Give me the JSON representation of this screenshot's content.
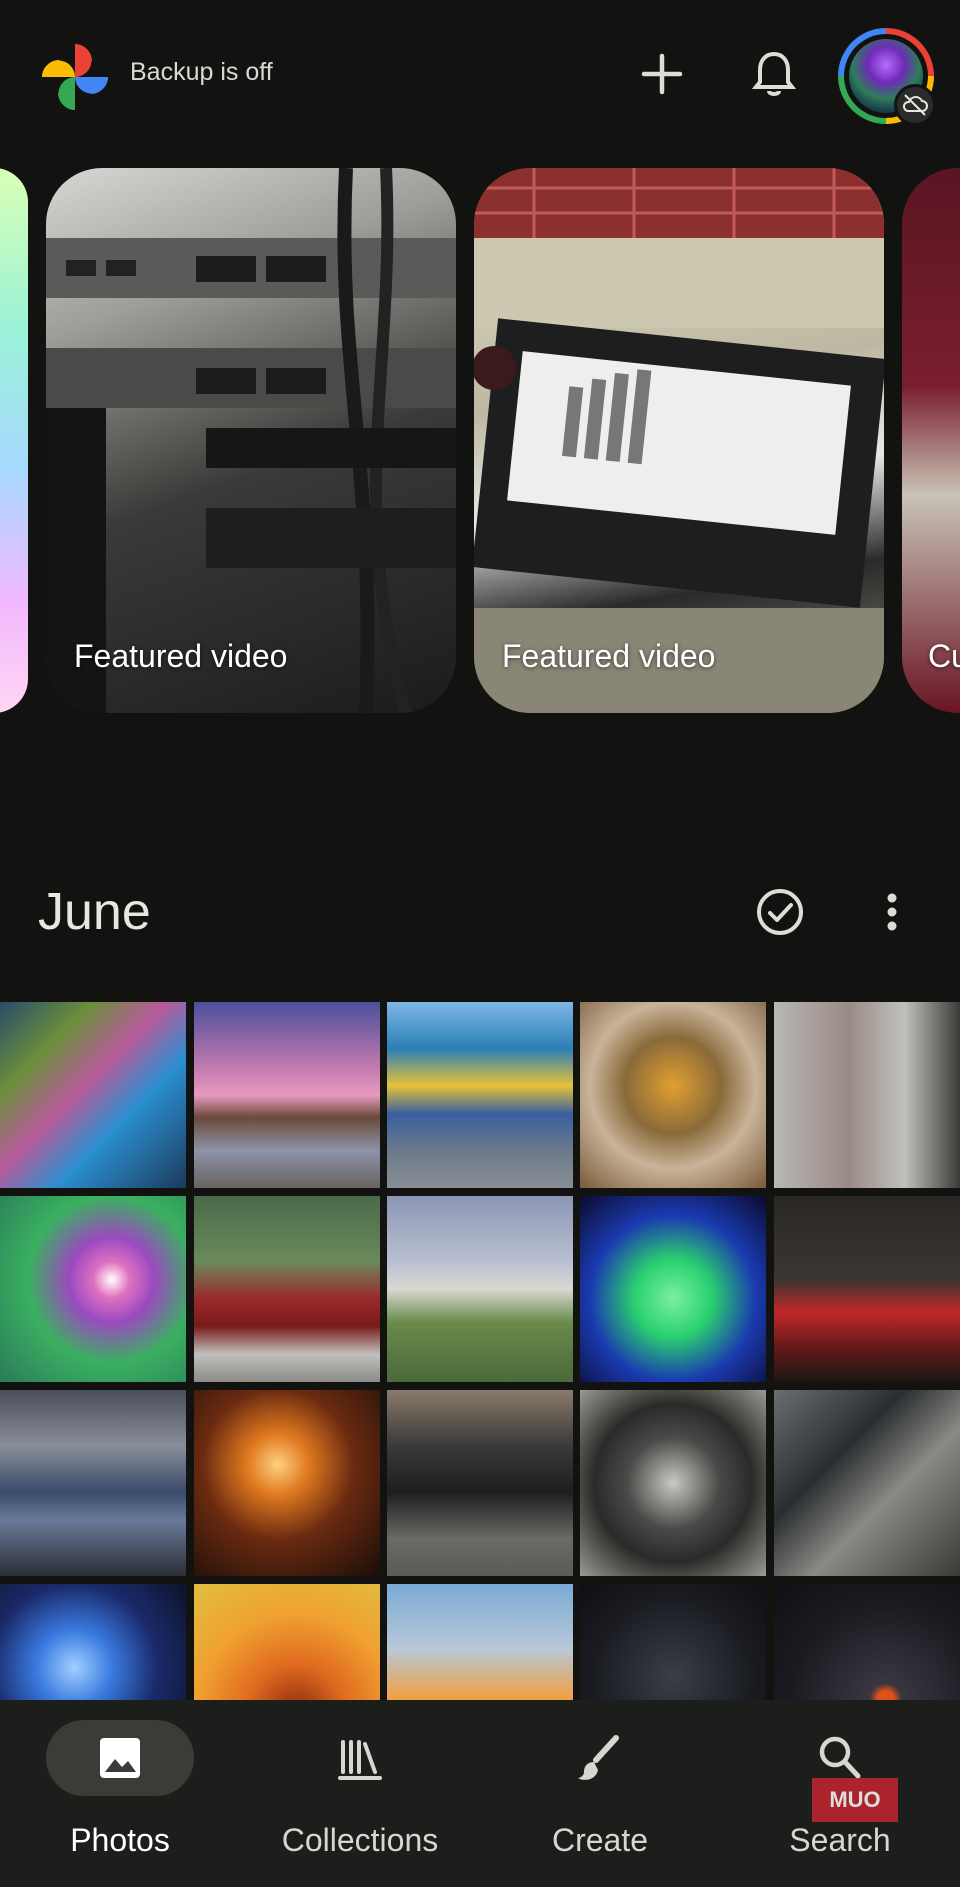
{
  "header": {
    "status_text": "Backup is off",
    "logo_icon": "google-photos-pinwheel-icon",
    "actions": [
      {
        "icon": "plus-icon"
      },
      {
        "icon": "bell-icon"
      },
      {
        "icon": "account-avatar"
      }
    ]
  },
  "memories": [
    {
      "label": ""
    },
    {
      "label": "Featured video"
    },
    {
      "label": "Featured video"
    },
    {
      "label": "Cu"
    }
  ],
  "section": {
    "title": "June",
    "select_icon": "check-circle-icon",
    "more_icon": "more-vert-icon"
  },
  "photos": {
    "rows": [
      [
        "weather-map-monitor",
        "sunset-beach",
        "pavilion-courtyard",
        "ornate-window-vase",
        "mural-building"
      ],
      [
        "typhoon-map",
        "red-suv",
        "lighthouse-hill",
        "glowing-glass-plate",
        "bridge-night-lights"
      ],
      [
        "light-beam-shore",
        "fire-performer",
        "black-car-garage",
        "car-dashboard",
        "engine-bay"
      ],
      [
        "blue-aurora-forest",
        "heat-map-australia",
        "lighthouse-sunset",
        "star-chart-dark",
        "star-chart-orange-dot"
      ]
    ]
  },
  "bottom_nav": {
    "items": [
      {
        "label": "Photos",
        "icon": "image-icon",
        "active": true
      },
      {
        "label": "Collections",
        "icon": "collections-icon",
        "active": false
      },
      {
        "label": "Create",
        "icon": "brush-icon",
        "active": false
      },
      {
        "label": "Search",
        "icon": "search-icon",
        "active": false
      }
    ]
  },
  "watermark": "MUO",
  "colors": {
    "background": "#121311",
    "nav_background": "#1c1e1b",
    "active_pill": "#3a3c38",
    "text": "#e6e6e3"
  }
}
